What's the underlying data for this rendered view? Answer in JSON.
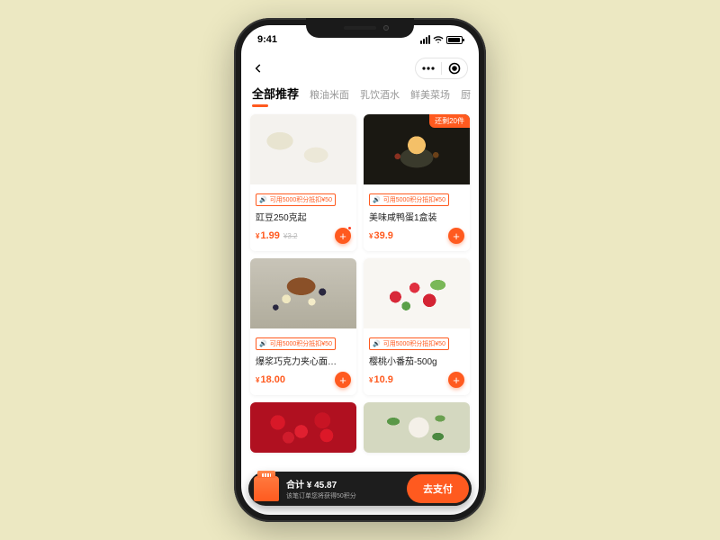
{
  "status": {
    "time": "9:41"
  },
  "capsule": {
    "more_icon": "more-icon",
    "target_icon": "target-icon"
  },
  "tabs": [
    {
      "label": "全部推荐",
      "active": true
    },
    {
      "label": "粮油米面"
    },
    {
      "label": "乳饮酒水"
    },
    {
      "label": "鲜美菜场"
    },
    {
      "label": "厨"
    }
  ],
  "promo_text": "可用5000积分抵扣¥50",
  "products": [
    {
      "title": "豇豆250克起",
      "price": "1.99",
      "old_price": "3.2",
      "has_dot": true
    },
    {
      "title": "美味咸鸭蛋1盒装",
      "price": "39.9",
      "stock_badge": "还剩20件"
    },
    {
      "title": "爆浆巧克力夹心面…",
      "price": "18.00"
    },
    {
      "title": "樱桃小番茄-500g",
      "price": "10.9"
    }
  ],
  "checkout": {
    "total_label": "合计",
    "currency": "¥",
    "total_amount": "45.87",
    "points_note": "该笔订单您将获得50积分",
    "pay_label": "去支付"
  },
  "colors": {
    "accent": "#ff5a1f",
    "bg": "#ece8c2"
  }
}
